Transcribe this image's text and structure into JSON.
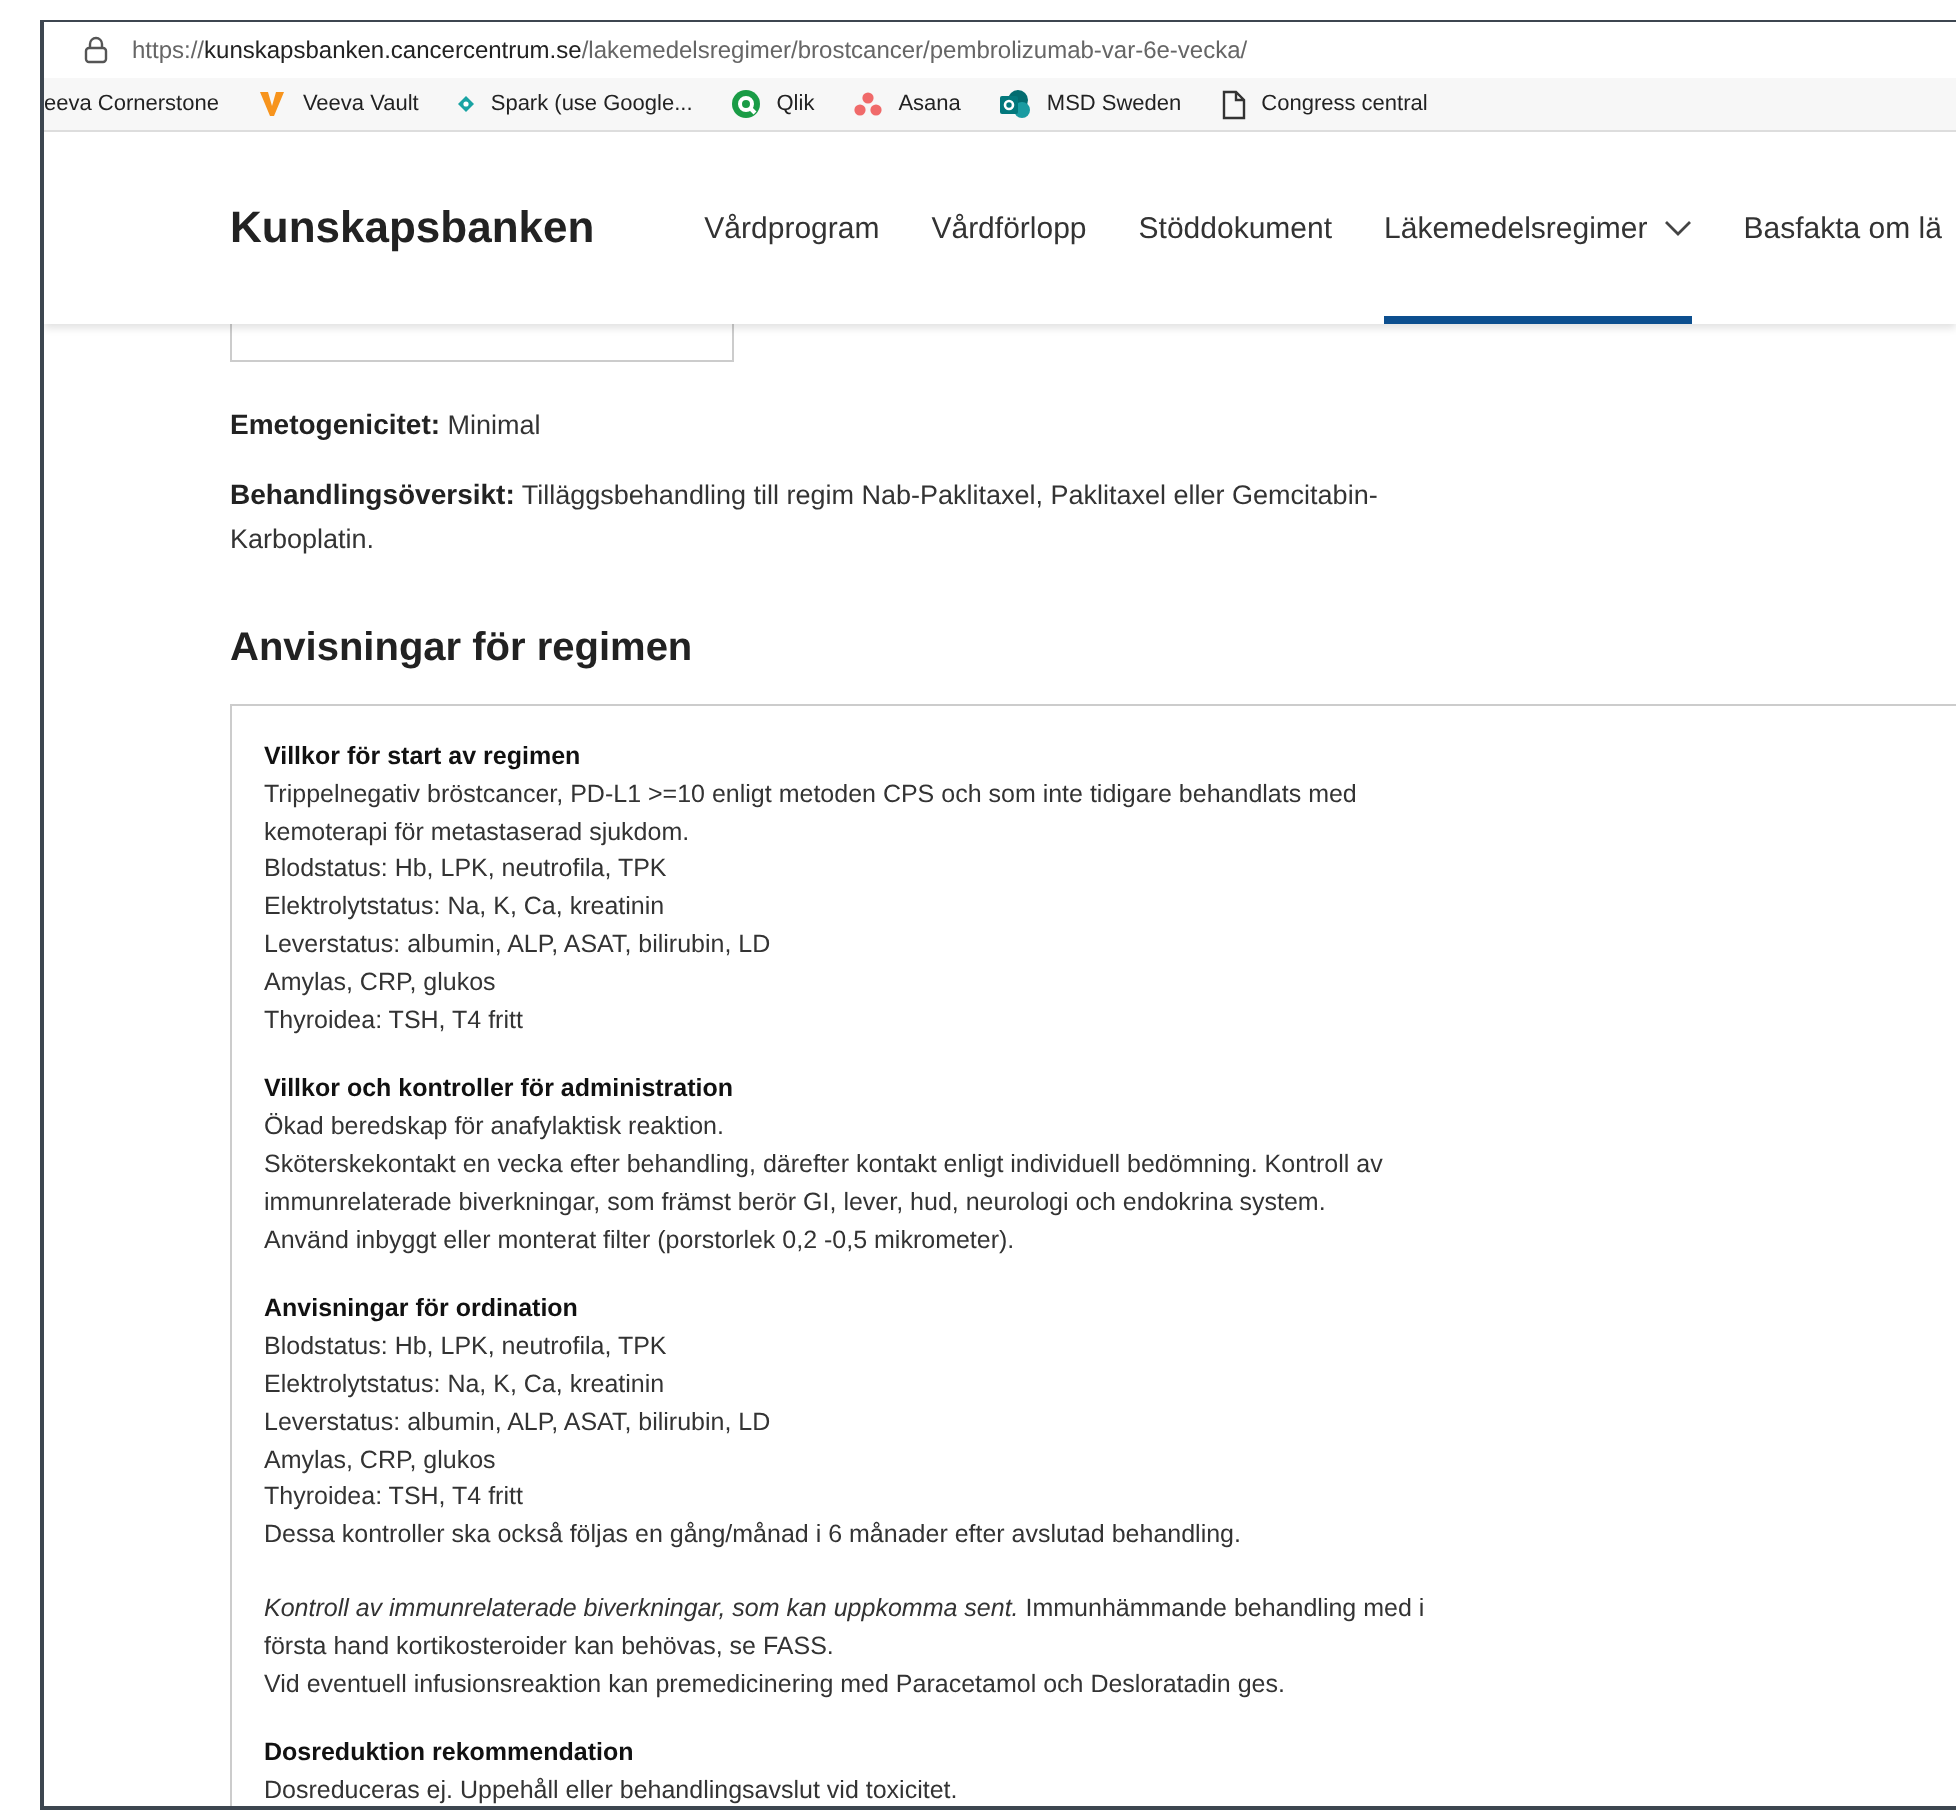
{
  "browser": {
    "url": {
      "scheme": "https://",
      "host": "kunskapsbanken.cancercentrum.se",
      "path": "/lakemedelsregimer/brostcancer/pembrolizumab-var-6e-vecka/"
    },
    "bookmarks": [
      {
        "label": "eeva Cornerstone",
        "kind": "none"
      },
      {
        "label": "Veeva Vault",
        "kind": "veeva"
      },
      {
        "label": "Spark (use Google...",
        "kind": "spark"
      },
      {
        "label": "Qlik",
        "kind": "qlik"
      },
      {
        "label": "Asana",
        "kind": "asana"
      },
      {
        "label": "MSD Sweden",
        "kind": "sharepoint"
      },
      {
        "label": "Congress central",
        "kind": "page"
      }
    ]
  },
  "header": {
    "logo": "Kunskapsbanken",
    "nav": [
      {
        "label": "Vårdprogram",
        "selected": false,
        "dropdown": false
      },
      {
        "label": "Vårdförlopp",
        "selected": false,
        "dropdown": false
      },
      {
        "label": "Stöddokument",
        "selected": false,
        "dropdown": false
      },
      {
        "label": "Läkemedelsregimer",
        "selected": true,
        "dropdown": true
      },
      {
        "label": "Basfakta om lä",
        "selected": false,
        "dropdown": false
      }
    ]
  },
  "meta": [
    {
      "label": "Emetogenicitet:",
      "value": "Minimal"
    },
    {
      "label": "Behandlingsöversikt:",
      "value": "Tilläggsbehandling till regim Nab-Paklitaxel, Paklitaxel eller Gemcitabin-Karboplatin."
    }
  ],
  "heading": "Anvisningar för regimen",
  "sections": [
    {
      "title": "Villkor för start av regimen",
      "paragraphs": [
        [
          "Trippelnegativ bröstcancer, PD-L1 >=10 enligt metoden CPS och som inte tidigare behandlats med kemoterapi för metastaserad sjukdom.",
          "Blodstatus: Hb, LPK, neutrofila, TPK",
          "Elektrolytstatus: Na, K, Ca, kreatinin",
          "Leverstatus: albumin, ALP, ASAT, bilirubin, LD",
          "Amylas, CRP, glukos",
          "Thyroidea: TSH, T4 fritt"
        ]
      ]
    },
    {
      "title": "Villkor och kontroller för administration",
      "paragraphs": [
        [
          "Ökad beredskap för anafylaktisk reaktion.",
          "Sköterskekontakt en vecka efter behandling, därefter kontakt enligt individuell bedömning. Kontroll av immunrelaterade biverkningar, som främst berör GI, lever, hud, neurologi och endokrina system.",
          "Använd inbyggt eller monterat filter (porstorlek 0,2 -0,5 mikrometer)."
        ]
      ]
    },
    {
      "title": "Anvisningar för ordination",
      "paragraphs": [
        [
          "Blodstatus: Hb, LPK, neutrofila, TPK",
          "Elektrolytstatus: Na, K, Ca, kreatinin",
          "Leverstatus: albumin, ALP, ASAT, bilirubin, LD",
          "Amylas, CRP, glukos",
          "Thyroidea: TSH, T4 fritt",
          "Dessa kontroller ska också följas en gång/månad i 6 månader efter avslutad behandling."
        ],
        [
          "*Kontroll av immunrelaterade biverkningar, som kan uppkomma sent.* Immunhämmande behandling med i första hand kortikosteroider kan behövas, se FASS.",
          "Vid eventuell infusionsreaktion kan premedicinering med Paracetamol och Desloratadin ges."
        ]
      ]
    },
    {
      "title": "Dosreduktion rekommendation",
      "paragraphs": [
        [
          "Dosreduceras ej. Uppehåll eller behandlingsavslut vid toxicitet."
        ]
      ]
    }
  ]
}
